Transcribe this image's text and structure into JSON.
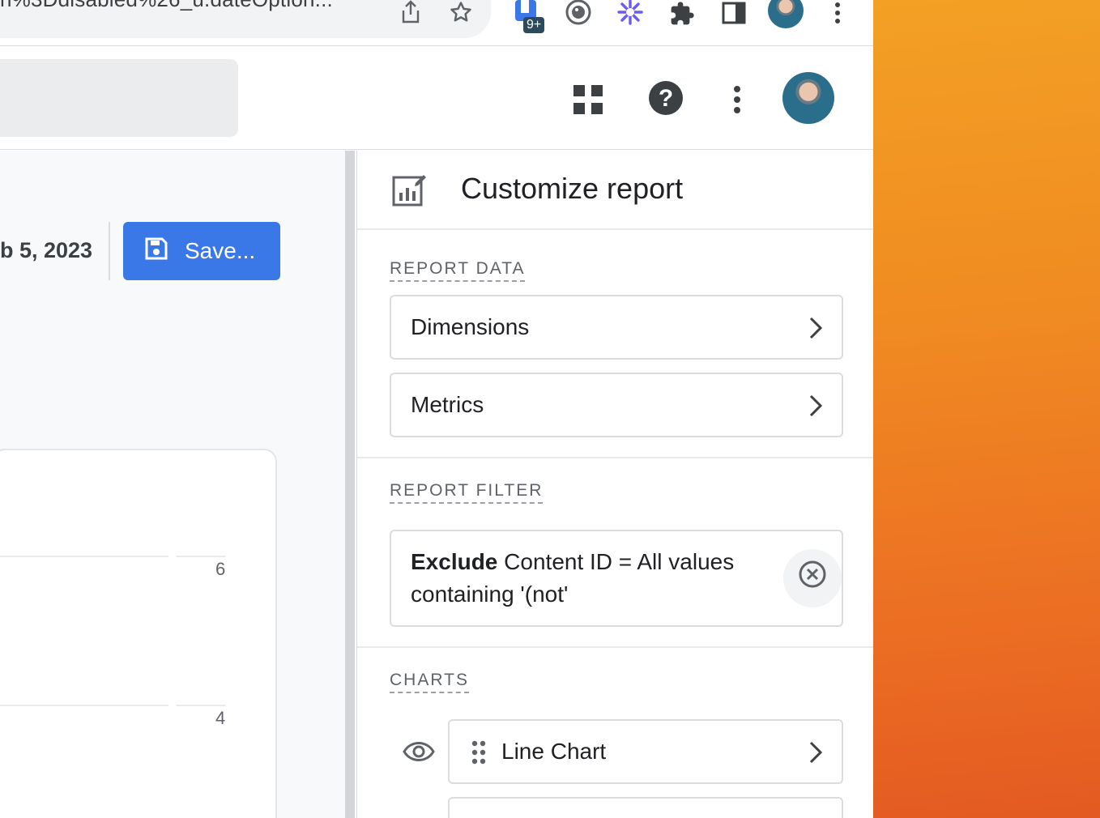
{
  "browser": {
    "url_text": "n%3Ddisabled%26_u.dateOption...",
    "extension_badge": "9+"
  },
  "app": {
    "header_icons": [
      "apps-grid-icon",
      "help-icon",
      "more-vert-icon",
      "account-avatar"
    ]
  },
  "report": {
    "date_text": "b 5, 2023",
    "save_label": "Save...",
    "y_ticks": [
      "6",
      "4"
    ]
  },
  "panel": {
    "title": "Customize report",
    "report_data_label": "REPORT DATA",
    "dimensions_label": "Dimensions",
    "metrics_label": "Metrics",
    "report_filter_label": "REPORT FILTER",
    "filter_bold": "Exclude",
    "filter_rest": " Content ID = All values containing '(not'",
    "charts_label": "CHARTS",
    "chart_item_label": "Line Chart"
  },
  "colors": {
    "primary_button": "#3b78e7",
    "desktop_gradient_top": "#f3a024",
    "desktop_gradient_bottom": "#e35a22"
  }
}
